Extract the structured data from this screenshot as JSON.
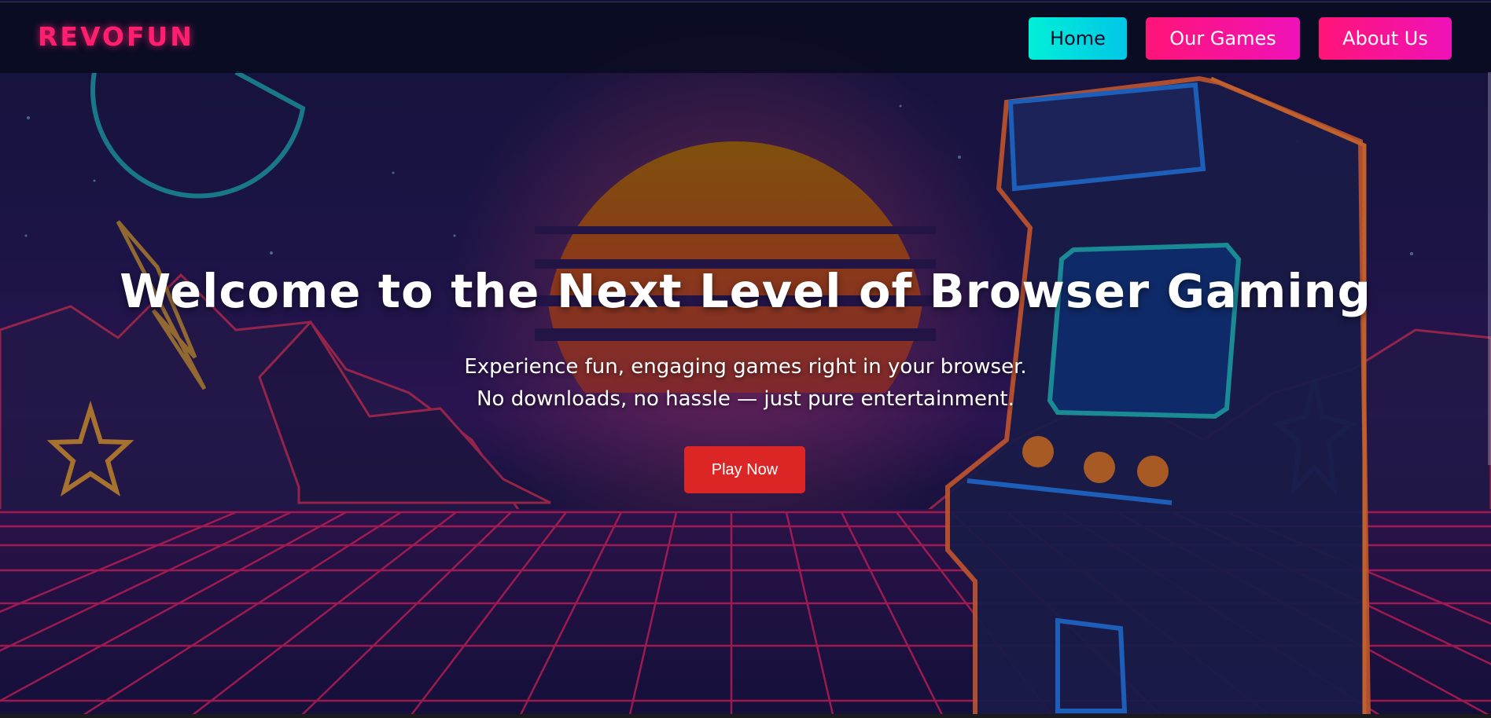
{
  "brand": {
    "logo": "REVOFUN"
  },
  "nav": {
    "items": [
      {
        "label": "Home",
        "active": true
      },
      {
        "label": "Our Games",
        "active": false
      },
      {
        "label": "About Us",
        "active": false
      }
    ]
  },
  "hero": {
    "title": "Welcome to the Next Level of Browser Gaming",
    "subtitle_line1": "Experience fun, engaging games right in your browser.",
    "subtitle_line2": "No downloads, no hassle — just pure entertainment.",
    "cta_label": "Play Now"
  },
  "colors": {
    "logo": "#ff1f6e",
    "home_button": "#00e5d8",
    "pink_button": "#ff1478",
    "cta_button": "#dc2626",
    "background": "#1a1440"
  },
  "icons": [
    "arcade-cabinet-illustration",
    "sun-icon",
    "star-icon",
    "lightning-icon",
    "pac-man-shape"
  ]
}
